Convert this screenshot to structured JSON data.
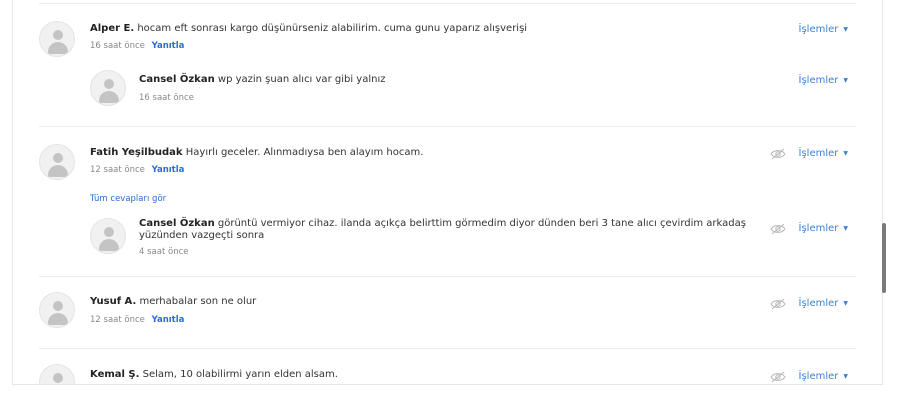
{
  "comments": [
    {
      "author": "Alper E.",
      "text": "hocam eft sonrası kargo düşünürseniz alabilirim. cuma gunu yaparız alışverişi",
      "time": "16 saat önce",
      "reply": "Yanıtla",
      "actions": "İşlemler",
      "replies": [
        {
          "author": "Cansel Özkan",
          "text": "wp yazin şuan alıcı var gibi yalnız",
          "time": "16 saat önce",
          "actions": "İşlemler"
        }
      ]
    },
    {
      "author": "Fatih Yeşilbudak",
      "text": "Hayırlı geceler. Alınmadıysa ben alayım hocam.",
      "time": "12 saat önce",
      "reply": "Yanıtla",
      "actions": "İşlemler",
      "see_all": "Tüm cevapları gör",
      "replies": [
        {
          "author": "Cansel Özkan",
          "text_line1": "görüntü vermiyor cihaz. ilanda açıkça belirttim görmedim diyor dünden beri 3 tane alıcı çevirdim arkadaş",
          "text_line2": "yüzünden vazgeçti sonra",
          "time": "4 saat önce",
          "actions": "İşlemler"
        }
      ]
    },
    {
      "author": "Yusuf A.",
      "text": "merhabalar son ne olur",
      "time": "12 saat önce",
      "reply": "Yanıtla",
      "actions": "İşlemler"
    },
    {
      "author": "Kemal Ş.",
      "text": "Selam, 10 olabilirmi yarın elden alsam.",
      "actions": "İşlemler"
    }
  ],
  "icons": {
    "avatar": "user-silhouette-icon",
    "hide": "eye-slash-icon",
    "caret": "caret-down-icon"
  },
  "colors": {
    "link": "#2c6bd6",
    "actions": "#3b82d6",
    "text": "#333333",
    "meta": "#888888"
  }
}
